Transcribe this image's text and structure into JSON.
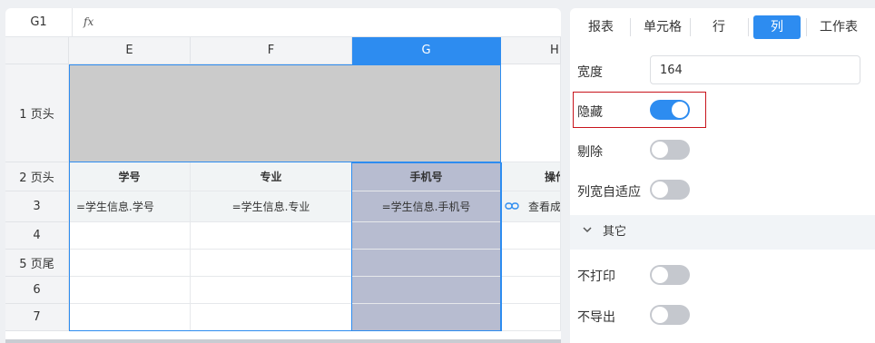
{
  "formula_bar": {
    "cell_ref": "G1",
    "fx_label": "fx"
  },
  "columns": [
    "E",
    "F",
    "G",
    "H"
  ],
  "rows": [
    {
      "num": "1 页头"
    },
    {
      "num": "2 页头"
    },
    {
      "num": "3"
    },
    {
      "num": "4"
    },
    {
      "num": "5 页尾"
    },
    {
      "num": "6"
    },
    {
      "num": "7"
    }
  ],
  "header_row": [
    "学号",
    "专业",
    "手机号",
    "操作"
  ],
  "data_row": [
    "=学生信息.学号",
    "=学生信息.专业",
    "=学生信息.手机号",
    "查看成"
  ],
  "panel": {
    "tabs": [
      "报表",
      "单元格",
      "行",
      "列",
      "工作表"
    ],
    "active_tab": "列",
    "width_label": "宽度",
    "width_value": "164",
    "hidden_label": "隐藏",
    "hidden_on": true,
    "delete_label": "剔除",
    "delete_on": false,
    "autofit_label": "列宽自适应",
    "autofit_on": false,
    "section_title": "其它",
    "no_print_label": "不打印",
    "no_print_on": false,
    "no_export_label": "不导出",
    "no_export_on": false
  },
  "colors": {
    "accent": "#2d8cf0",
    "selection": "#b7bcd0",
    "header_merged": "#cbcbcb",
    "highlight_border": "#c8141c"
  }
}
